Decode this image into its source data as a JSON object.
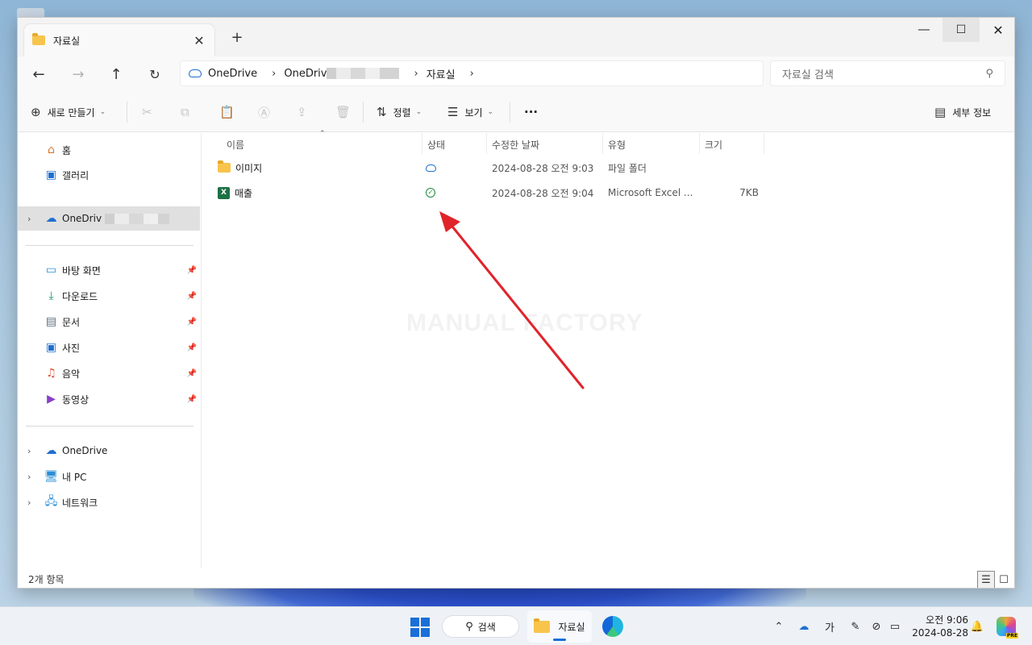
{
  "window": {
    "tab_title": "자료실",
    "new_tab": "+",
    "tab_close": "✕"
  },
  "addressbar": {
    "crumbs": [
      "OneDrive",
      "OneDriv",
      "자료실"
    ]
  },
  "search": {
    "placeholder": "자료실 검색"
  },
  "command_bar": {
    "new": "새로 만들기",
    "sort": "정렬",
    "view": "보기",
    "more": "···",
    "details": "세부 정보"
  },
  "sidebar": {
    "home": "홈",
    "gallery": "갤러리",
    "onedrive_personal": "OneDriv",
    "desktop": "바탕 화면",
    "downloads": "다운로드",
    "documents": "문서",
    "pictures": "사진",
    "music": "음악",
    "videos": "동영상",
    "onedrive": "OneDrive",
    "this_pc": "내 PC",
    "network": "네트워크"
  },
  "columns": {
    "name": "이름",
    "status": "상태",
    "modified": "수정한 날짜",
    "type": "유형",
    "size": "크기"
  },
  "files": [
    {
      "name": "이미지",
      "status": "cloud",
      "modified": "2024-08-28 오전 9:03",
      "type": "파일 폴더",
      "size": ""
    },
    {
      "name": "매출",
      "status": "synced",
      "modified": "2024-08-28 오전 9:04",
      "type": "Microsoft Excel ...",
      "size": "7KB"
    }
  ],
  "watermark": "MANUAL FACTORY",
  "status_bar": {
    "count": "2개 항목"
  },
  "taskbar": {
    "search": "검색",
    "explorer": "자료실",
    "ime": "가",
    "time": "오전 9:06",
    "date": "2024-08-28",
    "copilot_badge": "PRE"
  },
  "colors": {
    "accent": "#1a6fd8",
    "arrow": "#e0242b",
    "excel": "#1d7145",
    "folder": "#f8c44c",
    "sync_ok": "#1e8b3a"
  }
}
